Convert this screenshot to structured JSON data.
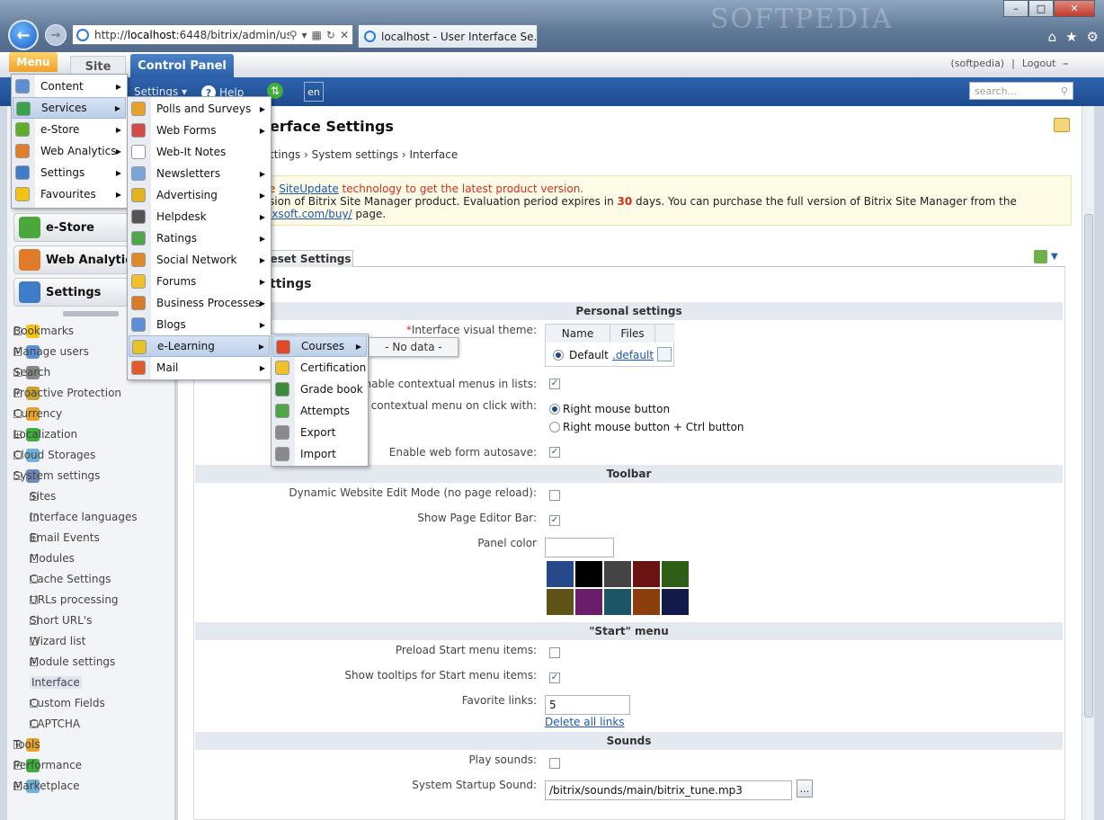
{
  "browser": {
    "url_prefix": "http://",
    "url_host": "localhost",
    "url_rest": ":6448/bitrix/admin/use",
    "tab_title": "localhost - User Interface Se...",
    "watermark": "SOFTPEDIA"
  },
  "admin": {
    "menu_label": "Menu",
    "site_tab": "Site",
    "control_panel_tab": "Control Panel",
    "user": "(softpedia)",
    "logout": "Logout",
    "settings_btn": "Settings",
    "help_btn": "Help",
    "lang": "en",
    "search_placeholder": "search..."
  },
  "sidebar": {
    "big_buttons": [
      "e-Store",
      "Web Analytics",
      "Settings"
    ],
    "tree": [
      {
        "label": "Bookmarks",
        "level": 0,
        "pm": "-"
      },
      {
        "label": "Manage users",
        "level": 0,
        "pm": "+"
      },
      {
        "label": "Search",
        "level": 0,
        "pm": "+"
      },
      {
        "label": "Proactive Protection",
        "level": 0,
        "pm": "+"
      },
      {
        "label": "Currency",
        "level": 0,
        "pm": "-"
      },
      {
        "label": "Localization",
        "level": 0,
        "pm": "+"
      },
      {
        "label": "Cloud Storages",
        "level": 0,
        "pm": "-"
      },
      {
        "label": "System settings",
        "level": 0,
        "pm": "-"
      },
      {
        "label": "Sites",
        "level": 1,
        "pm": "+"
      },
      {
        "label": "Interface languages",
        "level": 1,
        "pm": "-"
      },
      {
        "label": "Email Events",
        "level": 1,
        "pm": "+"
      },
      {
        "label": "Modules",
        "level": 1,
        "pm": "-"
      },
      {
        "label": "Cache Settings",
        "level": 1,
        "pm": "-"
      },
      {
        "label": "URLs processing",
        "level": 1,
        "pm": "-"
      },
      {
        "label": "Short URL's",
        "level": 1,
        "pm": "-"
      },
      {
        "label": "Wizard list",
        "level": 1,
        "pm": "-"
      },
      {
        "label": "Module settings",
        "level": 1,
        "pm": "+"
      },
      {
        "label": "Interface",
        "level": 1,
        "pm": "-"
      },
      {
        "label": "Custom Fields",
        "level": 1,
        "pm": "-"
      },
      {
        "label": "CAPTCHA",
        "level": 1,
        "pm": "-"
      },
      {
        "label": "Tools",
        "level": 0,
        "pm": "+"
      },
      {
        "label": "Performance",
        "level": 0,
        "pm": "+"
      },
      {
        "label": "Marketplace",
        "level": 0,
        "pm": "+"
      }
    ]
  },
  "page": {
    "title": "erface Settings",
    "breadcrumb": "ttings › System settings › Interface",
    "notice_line1_a": "e ",
    "notice_link1": "SiteUpdate",
    "notice_line1_b": " technology to get the latest product version.",
    "notice_line2_a": "sion of Bitrix Site Manager product. Evaluation period expires in ",
    "notice_days": "30",
    "notice_line2_b": " days. You can purchase the full version of Bitrix Site Manager from the",
    "notice_link2": "ixsoft.com/buy/",
    "notice_line3": " page.",
    "preset_tab": "eset Settings",
    "section_title": "ttings"
  },
  "form": {
    "band_personal": "Personal settings",
    "theme_label": "Interface visual theme:",
    "theme_required": "*",
    "theme_col_name": "Name",
    "theme_col_files": "Files",
    "theme_name": "Default",
    "theme_file": ".default",
    "ctx_menus_label": "Enable contextual menus in lists:",
    "ctx_click_label": "v contextual menu on click with:",
    "radio_right": "Right mouse button",
    "radio_ctrl": "Right mouse button + Ctrl button",
    "autosave_label": "Enable web form autosave:",
    "band_toolbar": "Toolbar",
    "dyn_edit_label": "Dynamic Website Edit Mode (no page reload):",
    "editor_bar_label": "Show Page Editor Bar:",
    "panel_color_label": "Panel color",
    "band_start": "\"Start\" menu",
    "preload_label": "Preload Start menu items:",
    "tooltips_label": "Show tooltips for Start menu items:",
    "favlinks_label": "Favorite links:",
    "favlinks_value": "5",
    "delete_links": "Delete all links",
    "band_sounds": "Sounds",
    "play_sounds_label": "Play sounds:",
    "startup_sound_label": "System Startup Sound:",
    "startup_sound_value": "/bitrix/sounds/main/bitrix_tune.mp3",
    "browse": "...",
    "swatches": [
      "#26498a",
      "#000000",
      "#444444",
      "#6b1213",
      "#2f5f16",
      "#5f5318",
      "#6a1d6a",
      "#1c5666",
      "#8c3e0c",
      "#111a48"
    ]
  },
  "menus": {
    "main": [
      {
        "label": "Content",
        "icon": "content-icon",
        "color": "#5a8fd6"
      },
      {
        "label": "Services",
        "icon": "services-icon",
        "color": "#3aa24c"
      },
      {
        "label": "e-Store",
        "icon": "cart-icon",
        "color": "#5fae2a"
      },
      {
        "label": "Web Analytics",
        "icon": "analytics-icon",
        "color": "#e0802a"
      },
      {
        "label": "Settings",
        "icon": "gear-icon",
        "color": "#3f7cc8"
      },
      {
        "label": "Favourites",
        "icon": "star-icon",
        "color": "#f2c411"
      }
    ],
    "services": [
      {
        "label": "Polls and Surveys",
        "color": "#e6a22a"
      },
      {
        "label": "Web Forms",
        "color": "#d24c4c"
      },
      {
        "label": "Web-It Notes",
        "color": "#ffffff"
      },
      {
        "label": "Newsletters",
        "color": "#7aa5d8"
      },
      {
        "label": "Advertising",
        "color": "#e3b31f"
      },
      {
        "label": "Helpdesk",
        "color": "#555555"
      },
      {
        "label": "Ratings",
        "color": "#4fa64a"
      },
      {
        "label": "Social Network",
        "color": "#e08b2a"
      },
      {
        "label": "Forums",
        "color": "#f0c02a"
      },
      {
        "label": "Business Processes",
        "color": "#d77a2a"
      },
      {
        "label": "Blogs",
        "color": "#5a8fd6"
      },
      {
        "label": "e-Learning",
        "color": "#e6c12a"
      },
      {
        "label": "Mail",
        "color": "#e05a2a"
      }
    ],
    "elearning": [
      {
        "label": "Courses",
        "color": "#e0482a"
      },
      {
        "label": "Certification",
        "color": "#f0c02a"
      },
      {
        "label": "Grade book",
        "color": "#3a8a3a"
      },
      {
        "label": "Attempts",
        "color": "#4fa64a"
      },
      {
        "label": "Export",
        "color": "#8a8a8a"
      },
      {
        "label": "Import",
        "color": "#8a8a8a"
      }
    ],
    "no_data": "- No data -"
  }
}
